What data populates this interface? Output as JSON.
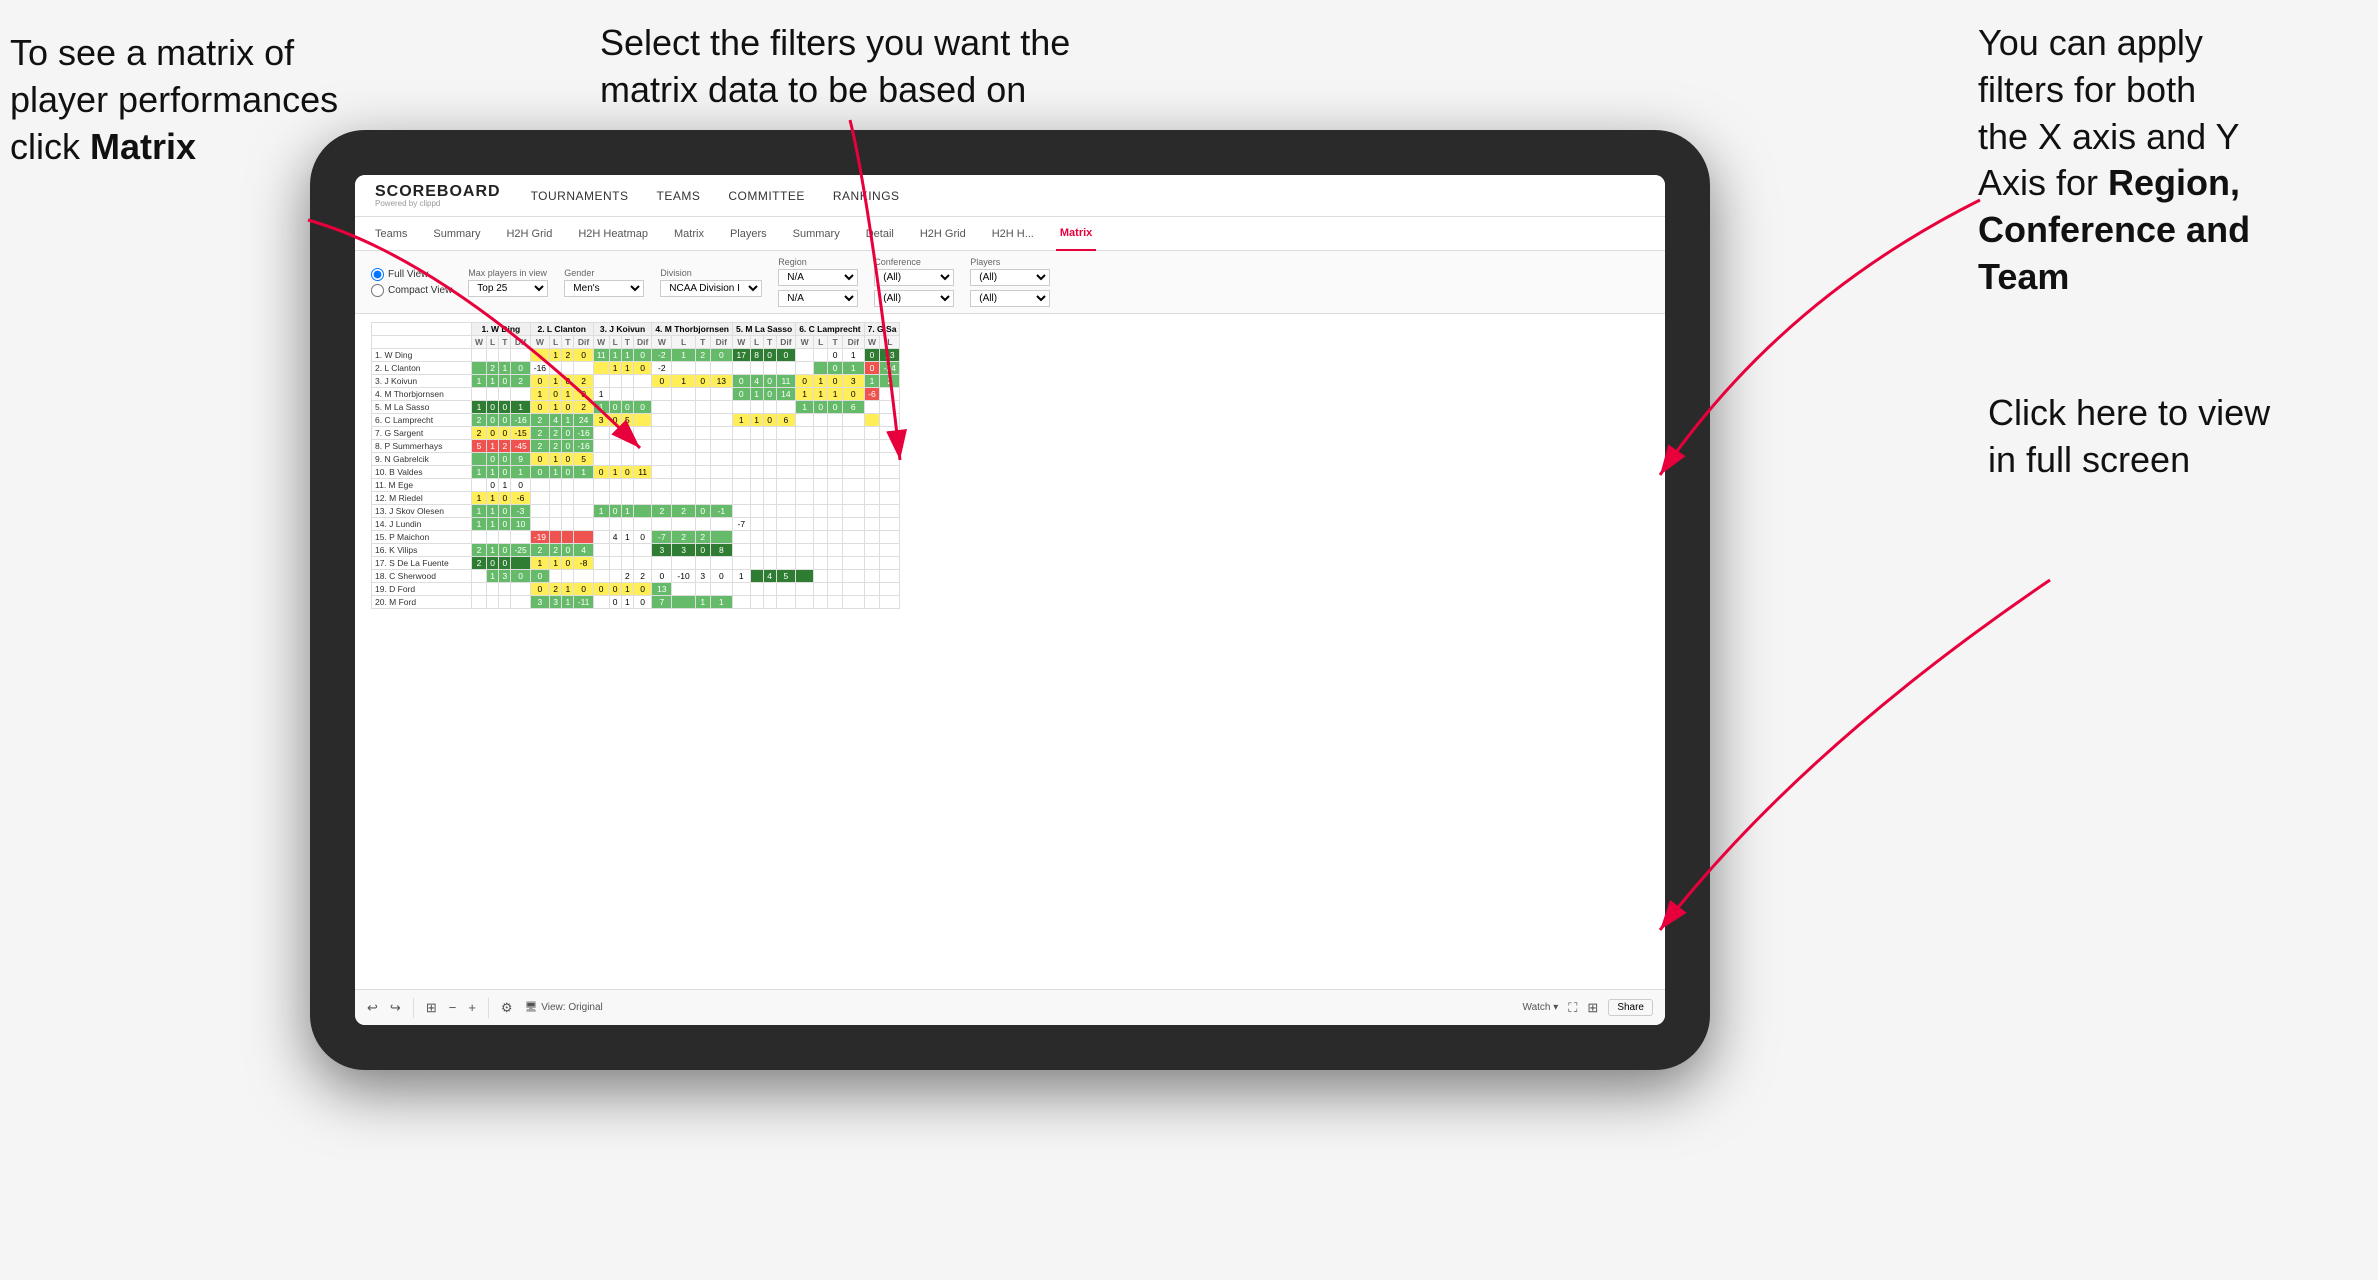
{
  "annotations": {
    "left": {
      "line1": "To see a matrix of",
      "line2": "player performances",
      "line3_prefix": "click ",
      "line3_bold": "Matrix"
    },
    "center": {
      "text": "Select the filters you want the matrix data to be based on"
    },
    "right_top": {
      "line1": "You  can apply",
      "line2": "filters for both",
      "line3": "the X axis and Y",
      "line4_prefix": "Axis for ",
      "line4_bold": "Region,",
      "line5_bold": "Conference and",
      "line6_bold": "Team"
    },
    "right_bottom": {
      "line1": "Click here to view",
      "line2": "in full screen"
    }
  },
  "nav": {
    "logo": "SCOREBOARD",
    "logo_sub": "Powered by clippd",
    "items": [
      "TOURNAMENTS",
      "TEAMS",
      "COMMITTEE",
      "RANKINGS"
    ]
  },
  "sub_nav": {
    "items": [
      "Teams",
      "Summary",
      "H2H Grid",
      "H2H Heatmap",
      "Matrix",
      "Players",
      "Summary",
      "Detail",
      "H2H Grid",
      "H2H H...",
      "Matrix"
    ],
    "active_index": 10
  },
  "filters": {
    "view_options": [
      "Full View",
      "Compact View"
    ],
    "max_players_label": "Max players in view",
    "max_players_value": "Top 25",
    "gender_label": "Gender",
    "gender_value": "Men's",
    "division_label": "Division",
    "division_value": "NCAA Division I",
    "region_label": "Region",
    "region_value": "N/A",
    "conference_label": "Conference",
    "conference_value": "(All)",
    "players_label": "Players",
    "players_value": "(All)"
  },
  "matrix": {
    "col_headers": [
      "1. W Ding",
      "2. L Clanton",
      "3. J Koivun",
      "4. M Thorbjornsen",
      "5. M La Sasso",
      "6. C Lamprecht",
      "7. G Sa"
    ],
    "sub_headers": [
      "W",
      "L",
      "T",
      "Dif"
    ],
    "rows": [
      {
        "name": "1. W Ding",
        "cells": []
      },
      {
        "name": "2. L Clanton",
        "cells": []
      },
      {
        "name": "3. J Koivun",
        "cells": []
      },
      {
        "name": "4. M Thorbjornsen",
        "cells": []
      },
      {
        "name": "5. M La Sasso",
        "cells": []
      },
      {
        "name": "6. C Lamprecht",
        "cells": []
      },
      {
        "name": "7. G Sargent",
        "cells": []
      },
      {
        "name": "8. P Summerhays",
        "cells": []
      },
      {
        "name": "9. N Gabrelcik",
        "cells": []
      },
      {
        "name": "10. B Valdes",
        "cells": []
      },
      {
        "name": "11. M Ege",
        "cells": []
      },
      {
        "name": "12. M Riedel",
        "cells": []
      },
      {
        "name": "13. J Skov Olesen",
        "cells": []
      },
      {
        "name": "14. J Lundin",
        "cells": []
      },
      {
        "name": "15. P Maichon",
        "cells": []
      },
      {
        "name": "16. K Vilips",
        "cells": []
      },
      {
        "name": "17. S De La Fuente",
        "cells": []
      },
      {
        "name": "18. C Sherwood",
        "cells": []
      },
      {
        "name": "19. D Ford",
        "cells": []
      },
      {
        "name": "20. M Ford",
        "cells": []
      }
    ]
  },
  "toolbar": {
    "view_label": "View: Original",
    "watch_label": "Watch",
    "share_label": "Share"
  }
}
